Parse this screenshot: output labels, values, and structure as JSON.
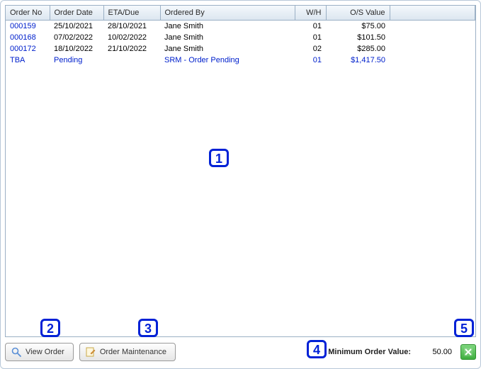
{
  "columns": {
    "order_no": "Order No",
    "order_date": "Order Date",
    "eta": "ETA/Due",
    "ordered_by": "Ordered By",
    "wh": "W/H",
    "os_value": "O/S Value"
  },
  "rows": [
    {
      "order_no": "000159",
      "order_date": "25/10/2021",
      "eta": "28/10/2021",
      "ordered_by": "Jane Smith",
      "wh": "01",
      "os_value": "$75.00",
      "pending": false
    },
    {
      "order_no": "000168",
      "order_date": "07/02/2022",
      "eta": "10/02/2022",
      "ordered_by": "Jane Smith",
      "wh": "01",
      "os_value": "$101.50",
      "pending": false
    },
    {
      "order_no": "000172",
      "order_date": "18/10/2022",
      "eta": "21/10/2022",
      "ordered_by": "Jane Smith",
      "wh": "02",
      "os_value": "$285.00",
      "pending": false
    },
    {
      "order_no": "TBA",
      "order_date": "Pending",
      "eta": "",
      "ordered_by": "SRM - Order Pending",
      "wh": "01",
      "os_value": "$1,417.50",
      "pending": true
    }
  ],
  "toolbar": {
    "view_order": "View Order",
    "order_maintenance": "Order Maintenance",
    "min_label": "Minimum Order Value:",
    "min_value": "50.00"
  },
  "callouts": {
    "c1": "1",
    "c2": "2",
    "c3": "3",
    "c4": "4",
    "c5": "5"
  }
}
